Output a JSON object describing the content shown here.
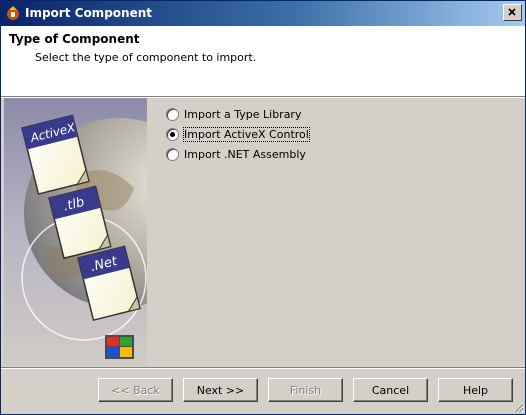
{
  "window": {
    "title": "Import Component"
  },
  "header": {
    "title": "Type of Component",
    "subtitle": "Select the type of component to import."
  },
  "art": {
    "labels": [
      "ActiveX",
      ".tlb",
      ".Net"
    ]
  },
  "options": [
    {
      "label": "Import a Type Library",
      "selected": false
    },
    {
      "label": "Import ActiveX Control",
      "selected": true
    },
    {
      "label": "Import .NET Assembly",
      "selected": false
    }
  ],
  "buttons": {
    "back": "<< Back",
    "next": "Next >>",
    "finish": "Finish",
    "cancel": "Cancel",
    "help": "Help"
  },
  "colors": {
    "titlebar_start": "#0a246a",
    "titlebar_end": "#a6caf0",
    "face": "#d4d0c8"
  }
}
